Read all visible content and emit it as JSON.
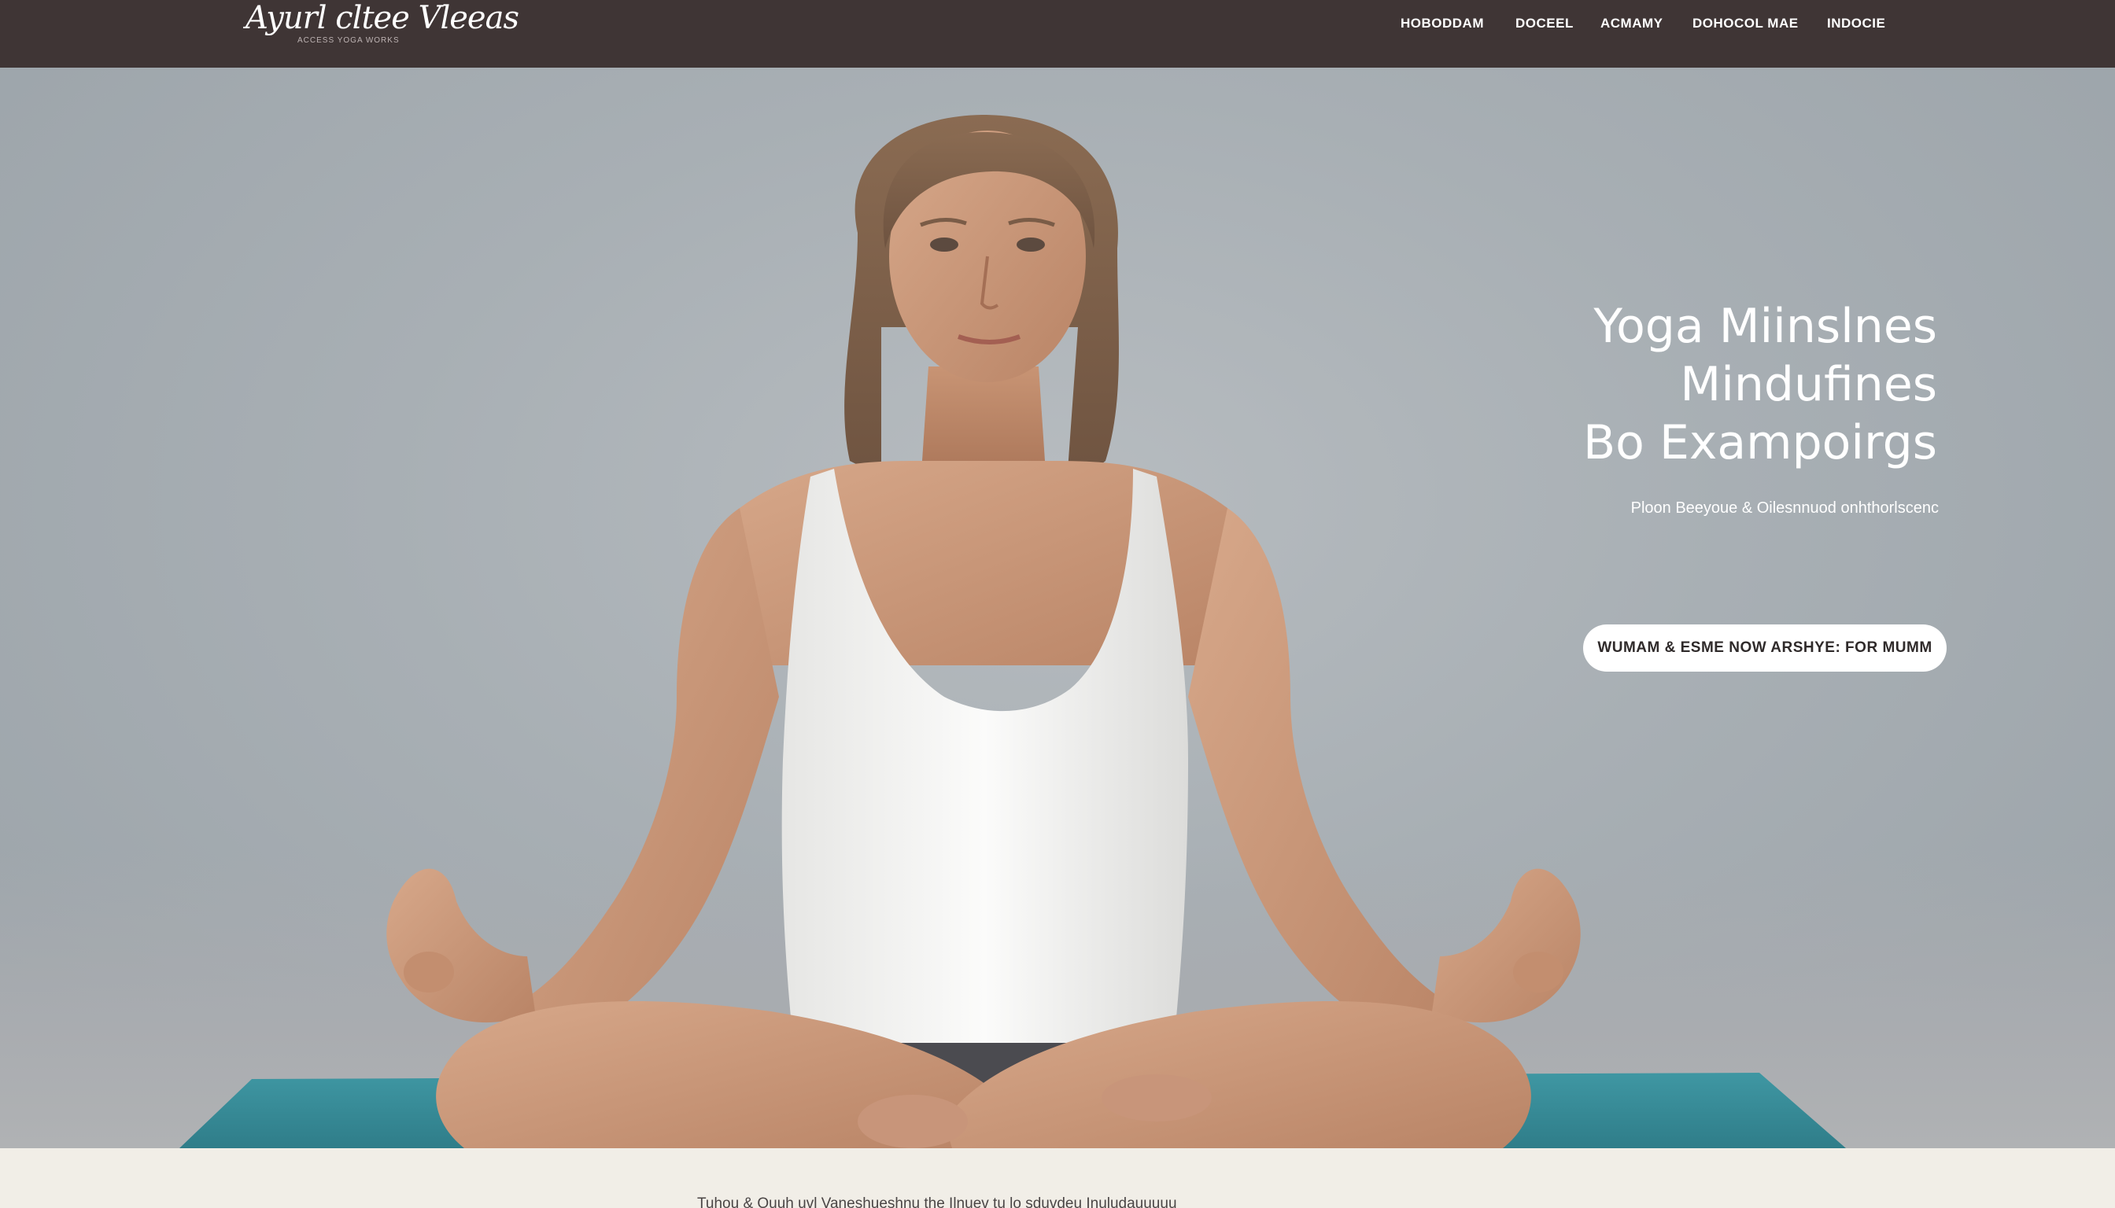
{
  "header": {
    "logo_text": "Ayurl cltee Vleeas",
    "logo_tagline": "ACCESS YOGA WORKS",
    "nav": [
      {
        "label": "HOBODDAM"
      },
      {
        "label": "DOCEEL"
      },
      {
        "label": "ACMAMY"
      },
      {
        "label": "DOHOCOL MAE"
      },
      {
        "label": "INDOCIE"
      }
    ]
  },
  "hero": {
    "title_lines": [
      "Yoga Miinslnes",
      "Mindufines",
      "Bo Exampoirgs"
    ],
    "subtitle": "Ploon Beeyoue & Oilesnnuod onhthorlscenc",
    "cta_label": "WUMAM & ESME NOW ARSHYE: FOR MUMM",
    "image_alt": "Woman seated cross-legged in meditation on a teal yoga mat",
    "colors": {
      "topbar": "#3f3535",
      "backdrop": "#a8afb4",
      "mat": "#3c8f9c",
      "tank_top": "#f4f4f2"
    }
  },
  "footer_strip": {
    "text": "Tuhou & Ouuh uvl Vaneshueshnu the Ilnuev tu lo sduvdeu Inuludauuuuu"
  }
}
